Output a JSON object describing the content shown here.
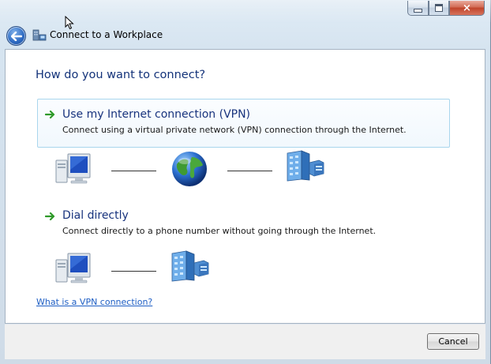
{
  "window": {
    "title": "Connect to a Workplace",
    "controls": {
      "minimize": "minimize",
      "maximize": "maximize",
      "close": "×"
    }
  },
  "instruction": "How do you want to connect?",
  "options": [
    {
      "title": "Use my Internet connection (VPN)",
      "description": "Connect using a virtual private network (VPN) connection through the Internet.",
      "icons": [
        "computer-icon",
        "globe-icon",
        "server-icon"
      ]
    },
    {
      "title": "Dial directly",
      "description": "Connect directly to a phone number without going through the Internet.",
      "icons": [
        "computer-icon",
        "server-icon"
      ]
    }
  ],
  "help_link": "What is a VPN connection?",
  "footer": {
    "cancel_label": "Cancel"
  },
  "colors": {
    "instruction_text": "#14337a",
    "option_title": "#18337d",
    "link": "#1e5ec4",
    "arrow_green": "#2f9a2a"
  }
}
